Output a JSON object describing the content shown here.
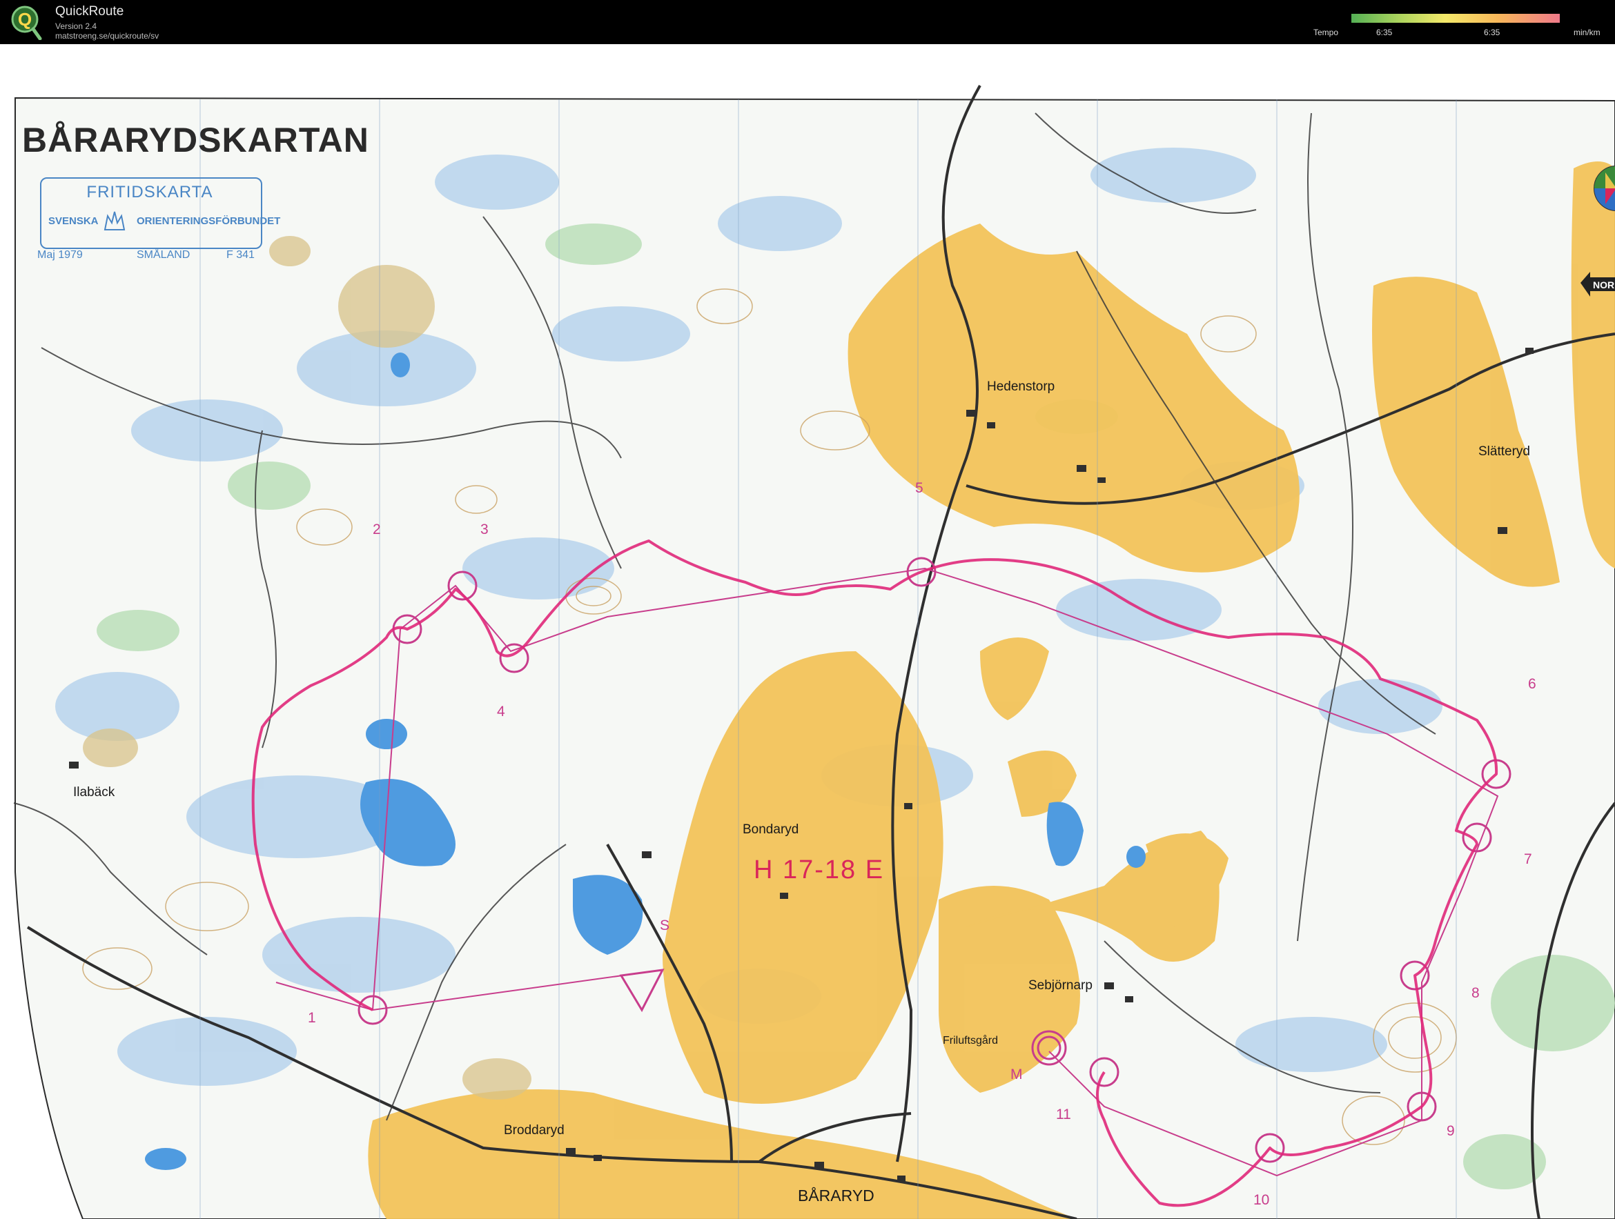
{
  "app": {
    "name": "QuickRoute",
    "version": "Version 2.4",
    "url": "matstroeng.se/quickroute/sv"
  },
  "legend": {
    "label": "Tempo",
    "min_value": "6:35",
    "max_value": "6:35",
    "unit": "min/km"
  },
  "map": {
    "title": "BÅRARYDSKARTAN",
    "stamp": {
      "title": "FRITIDSKARTA",
      "left_word": "SVENSKA",
      "right_word": "ORIENTERINGSFÖRBUNDET",
      "date": "Maj 1979",
      "region": "SMÅLAND",
      "number": "F 341"
    },
    "north_label": "NOR",
    "course_label": "H 17-18 E",
    "places": [
      "Hedenstorp",
      "Slätteryd",
      "Ilabäck",
      "Bondaryd",
      "Sebjörnarp",
      "Friluftsgård",
      "Broddaryd",
      "BÅRARYD"
    ],
    "controls": [
      "1",
      "2",
      "3",
      "4",
      "5",
      "6",
      "7",
      "8",
      "9",
      "10",
      "11",
      "S",
      "M"
    ]
  },
  "colors": {
    "field": "#f2c35a",
    "marsh_blue": "#a9c9e8",
    "lake": "#4f9be0",
    "green": "#b9dcb8",
    "route": "#e0287a",
    "course": "#c83d8c"
  }
}
